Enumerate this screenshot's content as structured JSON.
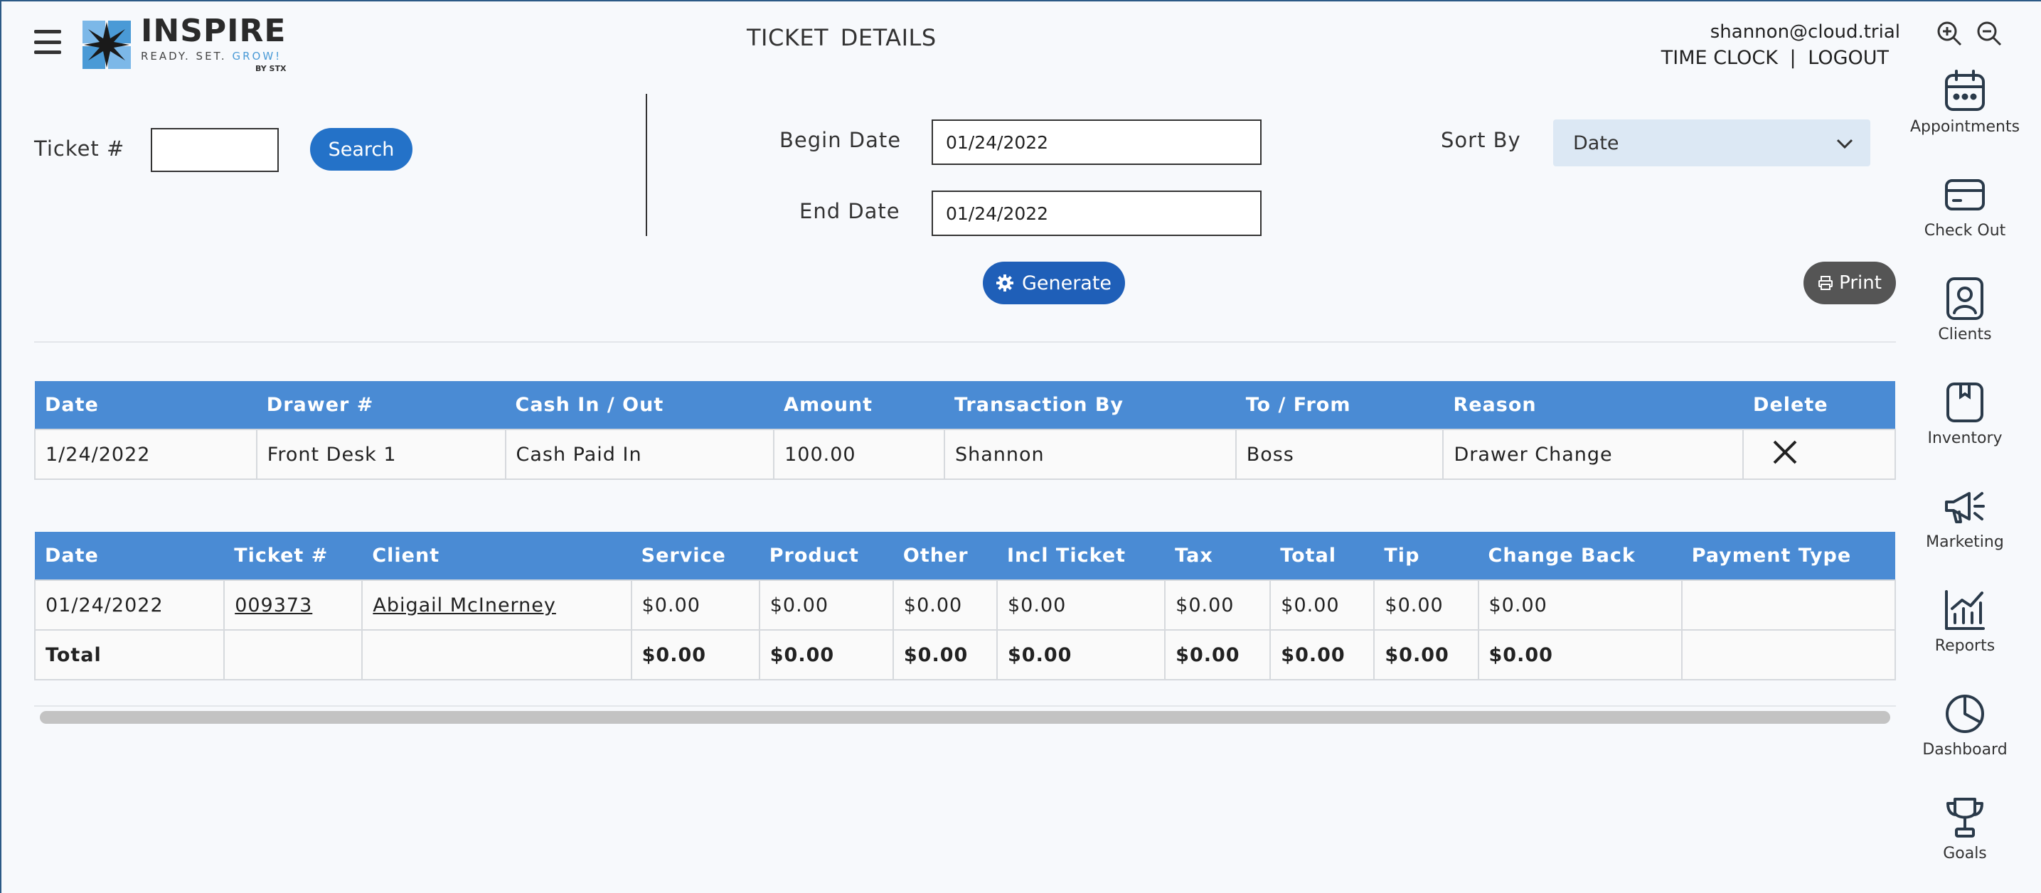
{
  "header": {
    "logo_word": "INSPIRE",
    "logo_tagline": "READY. SET. ",
    "logo_tagline_grow": "GROW!",
    "logo_by": "BY STX",
    "title": "TICKET  DETAILS",
    "user_email": "shannon@cloud.trial",
    "time_clock": "TIME CLOCK",
    "separator": "|",
    "logout": "LOGOUT"
  },
  "filters": {
    "ticket_label": "Ticket #",
    "ticket_value": "",
    "search_label": "Search",
    "begin_date_label": "Begin Date",
    "begin_date_value": "01/24/2022",
    "end_date_label": "End Date",
    "end_date_value": "01/24/2022",
    "sort_by_label": "Sort By",
    "sort_by_value": "Date",
    "generate_label": "Generate",
    "print_label": "Print"
  },
  "cash_table": {
    "headers": [
      "Date",
      "Drawer #",
      "Cash In / Out",
      "Amount",
      "Transaction By",
      "To / From",
      "Reason",
      "Delete"
    ],
    "rows": [
      [
        "1/24/2022",
        "Front Desk 1",
        "Cash Paid In",
        "100.00",
        "Shannon",
        "Boss",
        "Drawer Change"
      ]
    ]
  },
  "ticket_table": {
    "headers": [
      "Date",
      "Ticket #",
      "Client",
      "Service",
      "Product",
      "Other",
      "Incl Ticket",
      "Tax",
      "Total",
      "Tip",
      "Change Back",
      "Payment Type"
    ],
    "rows": [
      [
        "01/24/2022",
        "009373",
        "Abigail McInerney",
        "$0.00",
        "$0.00",
        "$0.00",
        "$0.00",
        "$0.00",
        "$0.00",
        "$0.00",
        "$0.00",
        ""
      ]
    ],
    "total_row": [
      "Total",
      "",
      "",
      "$0.00",
      "$0.00",
      "$0.00",
      "$0.00",
      "$0.00",
      "$0.00",
      "$0.00",
      "$0.00",
      ""
    ]
  },
  "sidebar": {
    "items": [
      {
        "label": "Appointments",
        "icon": "calendar-icon"
      },
      {
        "label": "Check Out",
        "icon": "credit-card-icon"
      },
      {
        "label": "Clients",
        "icon": "client-badge-icon"
      },
      {
        "label": "Inventory",
        "icon": "box-icon"
      },
      {
        "label": "Marketing",
        "icon": "megaphone-icon"
      },
      {
        "label": "Reports",
        "icon": "chart-icon"
      },
      {
        "label": "Dashboard",
        "icon": "pie-chart-icon"
      },
      {
        "label": "Goals",
        "icon": "trophy-icon"
      }
    ]
  },
  "colors": {
    "table_header": "#4a8bd4",
    "button_blue": "#2472c8",
    "print_button": "#555555",
    "select_bg": "#dce8f4"
  }
}
